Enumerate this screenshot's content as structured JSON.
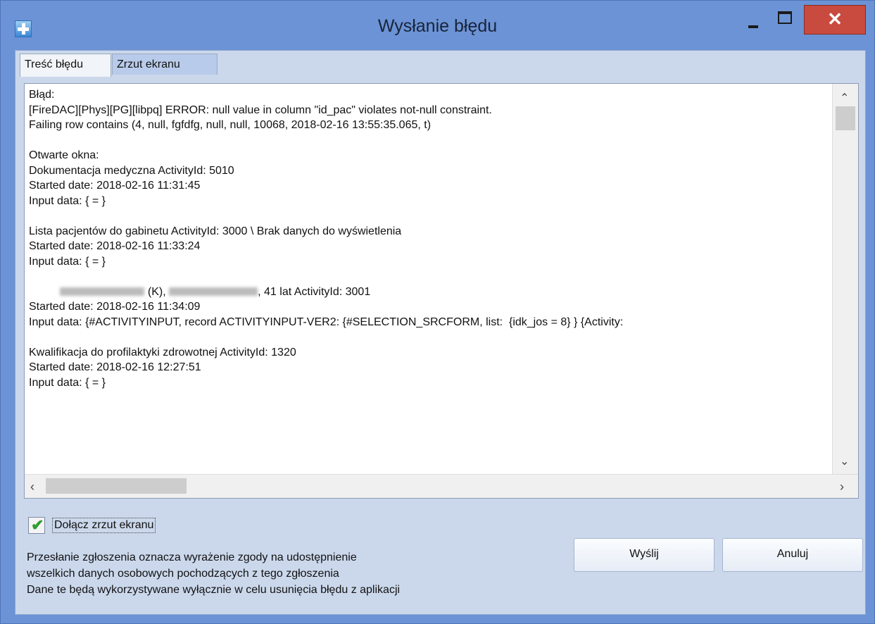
{
  "window": {
    "title": "Wysłanie błędu",
    "close_glyph": "✕"
  },
  "tabs": [
    {
      "label": "Treść błędu",
      "active": true
    },
    {
      "label": "Zrzut ekranu",
      "active": false
    }
  ],
  "error_text": {
    "l1": "Błąd:",
    "l2": "[FireDAC][Phys][PG][libpq] ERROR: null value in column \"id_pac\" violates not-null constraint.",
    "l3": "Failing row contains (4, null, fgfdfg, null, null, 10068, 2018-02-16 13:55:35.065, t)",
    "l5": "Otwarte okna:",
    "l6": "Dokumentacja medyczna ActivityId: 5010",
    "l7": "Started date: 2018-02-16 11:31:45",
    "l8": "Input data: { = }",
    "l10": "Lista pacjentów do gabinetu ActivityId: 3000 \\ Brak danych do wyświetlenia",
    "l11": "Started date: 2018-02-16 11:33:24",
    "l12": "Input data: { = }",
    "l14a": " (K), ",
    "l14b": ", 41 lat ActivityId: 3001",
    "l15": "Started date: 2018-02-16 11:34:09",
    "l16": "Input data: {#ACTIVITYINPUT, record ACTIVITYINPUT-VER2: {#SELECTION_SRCFORM, list:  {idk_jos = 8} } {Activity:",
    "l18": "Kwalifikacja do profilaktyki zdrowotnej ActivityId: 1320",
    "l19": "Started date: 2018-02-16 12:27:51",
    "l20": "Input data: { = }"
  },
  "attach_screenshot": {
    "label": "Dołącz zrzut ekranu",
    "checked": true
  },
  "notice": {
    "line1": "Przesłanie zgłoszenia oznacza wyrażenie zgody na udostępnienie",
    "line2": "wszelkich danych osobowych pochodzących z tego zgłoszenia",
    "line3": "Dane te będą wykorzystywane wyłącznie w celu usunięcia błędu z aplikacji"
  },
  "buttons": {
    "send": "Wyślij",
    "cancel": "Anuluj"
  },
  "colors": {
    "frame": "#6c93d6",
    "close": "#c94a3e",
    "client": "#cbd8ec",
    "checkmark": "#2f9d2f"
  }
}
